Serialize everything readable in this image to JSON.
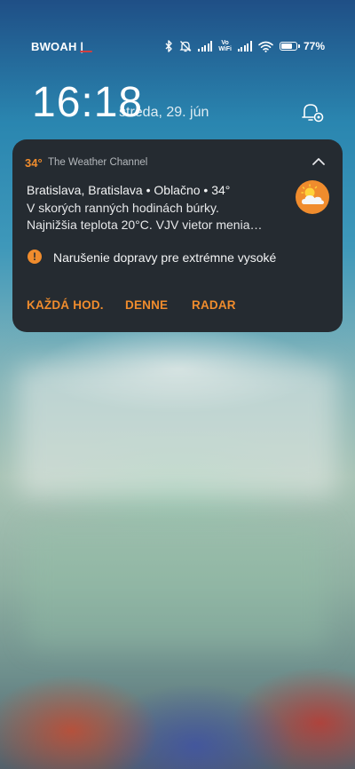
{
  "status_bar": {
    "carrier": "BWOAH |",
    "vowifi_top": "Vo",
    "vowifi_bottom": "WiFi",
    "battery_level": 0.77,
    "battery_percent": "77%",
    "icons": [
      "bluetooth-icon",
      "notifications-muted-icon",
      "signal-icon",
      "vowifi-icon",
      "signal-icon",
      "wifi-icon",
      "battery-icon"
    ]
  },
  "lockscreen": {
    "time": "16:18",
    "date": "streda, 29. jún"
  },
  "notification": {
    "temperature_badge": "34°",
    "app_name": "The Weather Channel",
    "title": "Bratislava, Bratislava • Oblačno • 34°",
    "line1": "V skorých ranných hodinách búrky.",
    "line2": "Najnižšia teplota 20°C. VJV vietor menia…",
    "alert_icon_glyph": "!",
    "alert_text": "Narušenie dopravy pre extrémne vysoké",
    "actions": [
      {
        "label": "KAŽDÁ HOD."
      },
      {
        "label": "DENNE"
      },
      {
        "label": "RADAR"
      }
    ],
    "accent_color": "#f08c2d",
    "card_color": "#252b31"
  }
}
